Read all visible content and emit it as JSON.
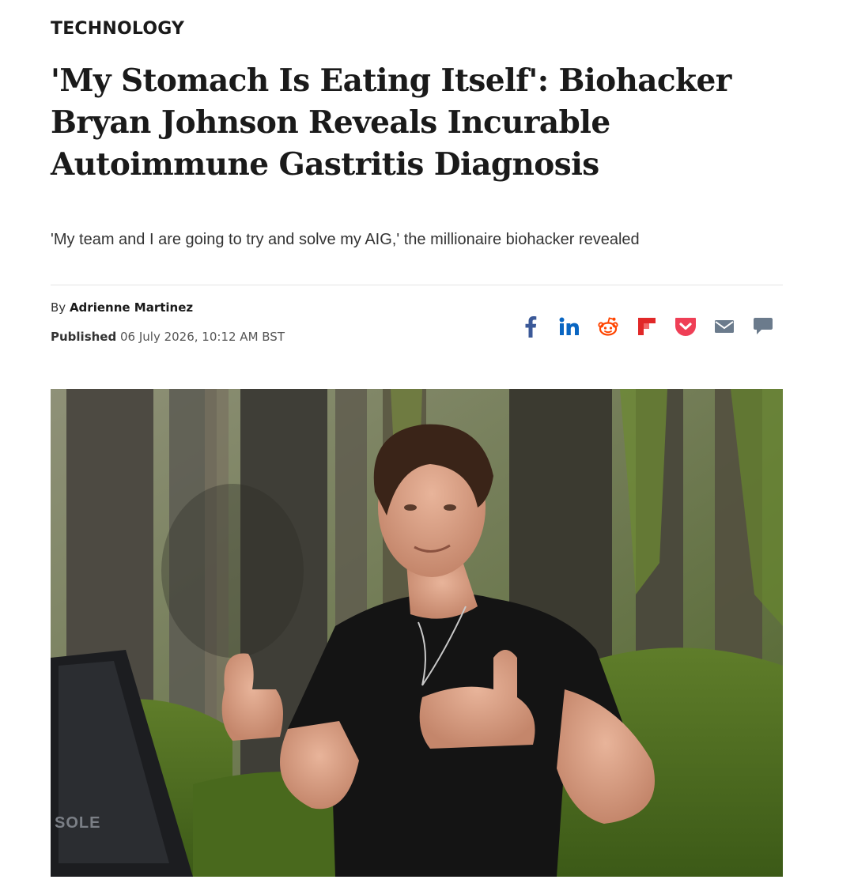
{
  "article": {
    "section": "TECHNOLOGY",
    "headline": "'My Stomach Is Eating Itself': Biohacker Bryan Johnson Reveals Incurable Autoimmune Gastritis Diagnosis",
    "standfirst": "'My team and I are going to try and solve my AIG,' the millionaire biohacker revealed",
    "byline_prefix": "By",
    "author": "Adrienne Martinez",
    "published_label": "Published",
    "published_date": "06 July 2026, 10:12 AM BST"
  },
  "share": {
    "items": [
      {
        "icon": "facebook-icon",
        "color": "#3b5998"
      },
      {
        "icon": "linkedin-icon",
        "color": "#0a66c2"
      },
      {
        "icon": "reddit-icon",
        "color": "#ff4500"
      },
      {
        "icon": "flipboard-icon",
        "color": "#e12828"
      },
      {
        "icon": "pocket-icon",
        "color": "#ef3f56"
      },
      {
        "icon": "email-icon",
        "color": "#6b7b8c"
      },
      {
        "icon": "comment-icon",
        "color": "#6b7b8c"
      }
    ]
  },
  "hero": {
    "alt": "Bryan Johnson giving two thumbs up in front of a forest backdrop",
    "equipment_label": "SOLE"
  }
}
